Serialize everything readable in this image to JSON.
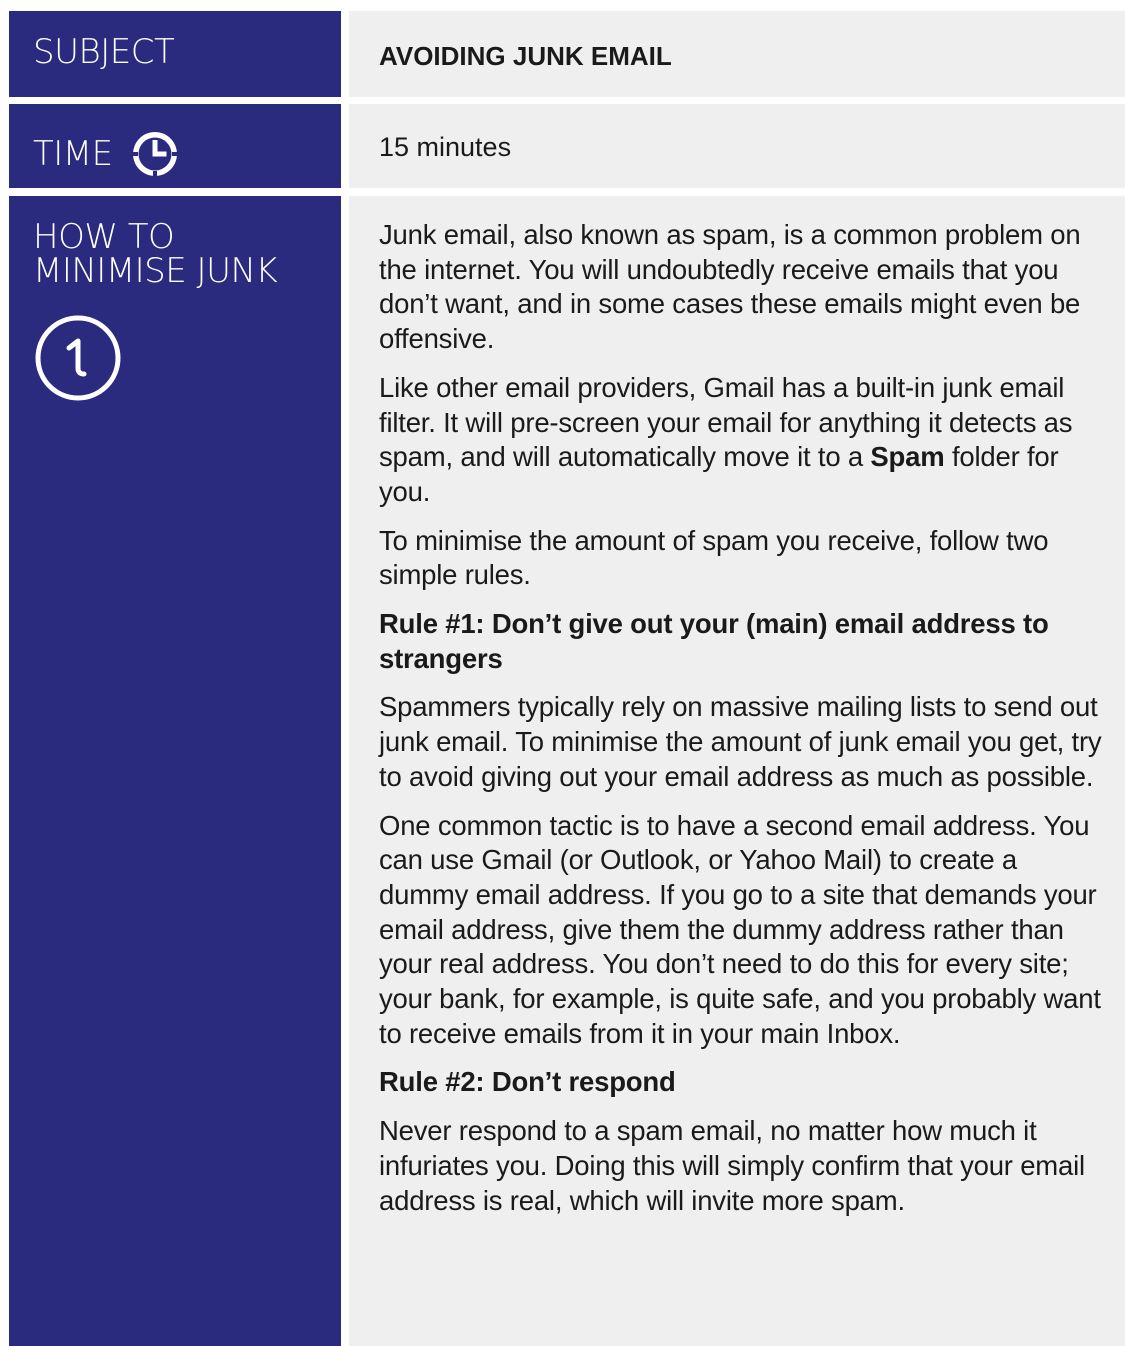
{
  "rows": {
    "subject": {
      "label": "SUBJECT",
      "value": "AVOIDING JUNK EMAIL"
    },
    "time": {
      "label": "TIME",
      "icon": "clock-icon",
      "value": "15 minutes"
    },
    "section": {
      "label_line1": "HOW TO",
      "label_line2": "MINIMISE JUNK",
      "step_number": "1",
      "step_icon": "number-one-circle-icon"
    }
  },
  "content": {
    "p1": "Junk email, also known as spam, is a common problem on the internet. You will undoubtedly receive emails that you don’t want, and in some cases these emails might even be offensive.",
    "p2_before": "Like other email providers, Gmail has a built-in junk email filter. It will pre-screen your email for anything it detects as spam, and will automatically move it to a ",
    "p2_bold": "Spam",
    "p2_after": " folder for you.",
    "p3": "To minimise the amount of spam you receive, follow two simple rules.",
    "rule1": "Rule #1: Don’t give out your (main) email address to strangers",
    "p4": "Spammers typically rely on massive mailing lists to send out junk email. To minimise the amount of junk email you get, try to avoid giving out your email address as much as possible.",
    "p5": "One common tactic is to have a second email address. You can use Gmail (or Outlook, or Yahoo Mail) to create a dummy email address. If you go to a site that demands your email address, give them the dummy address rather than your real address. You don’t need to do this for every site; your bank, for example, is quite safe, and you probably want to receive emails from it in your main Inbox.",
    "rule2": "Rule #2: Don’t respond",
    "p6": "Never respond to a spam email, no matter how much it infuriates you. Doing this will simply confirm that your email address is real, which will invite more spam."
  },
  "colors": {
    "left_panel": "#2a2a7e",
    "right_panel": "#efefef",
    "text": "#1a1a1a"
  }
}
